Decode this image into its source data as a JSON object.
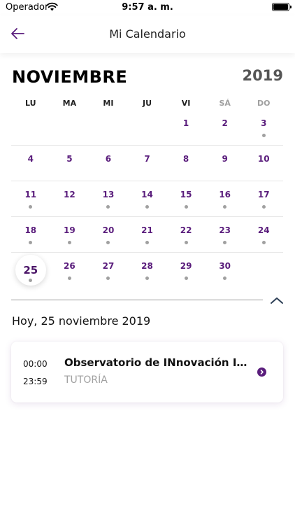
{
  "status_bar": {
    "carrier": "Operador",
    "time": "9:57 a. m."
  },
  "nav": {
    "title": "Mi Calendario",
    "back_icon": "arrow-left-icon"
  },
  "calendar": {
    "month": "NOVIEMBRE",
    "year": "2019",
    "weekdays": [
      "LU",
      "MA",
      "MI",
      "JU",
      "VI",
      "SÁ",
      "DO"
    ],
    "weeks": [
      [
        "",
        "",
        "",
        "",
        "1",
        "2",
        "3"
      ],
      [
        "4",
        "5",
        "6",
        "7",
        "8",
        "9",
        "10"
      ],
      [
        "11",
        "12",
        "13",
        "14",
        "15",
        "16",
        "17"
      ],
      [
        "18",
        "19",
        "20",
        "21",
        "22",
        "23",
        "24"
      ],
      [
        "25",
        "26",
        "27",
        "28",
        "29",
        "30",
        ""
      ]
    ],
    "today": "25",
    "days_with_events": [
      "3",
      "11",
      "13",
      "14",
      "15",
      "16",
      "17",
      "18",
      "19",
      "20",
      "21",
      "22",
      "23",
      "24",
      "25",
      "26",
      "27",
      "28",
      "29",
      "30"
    ]
  },
  "collapse_icon": "chevron-up-icon",
  "selected_day_label": "Hoy, 25 noviembre 2019",
  "events": [
    {
      "start": "00:00",
      "end": "23:59",
      "title": "Observatorio de INnovación INt...",
      "type": "TUTORÍA",
      "icon": "chevron-right-circle-icon"
    }
  ],
  "colors": {
    "accent": "#5a1d7c",
    "muted": "#a0a0a0",
    "event_dot": "#a0a0a0"
  }
}
